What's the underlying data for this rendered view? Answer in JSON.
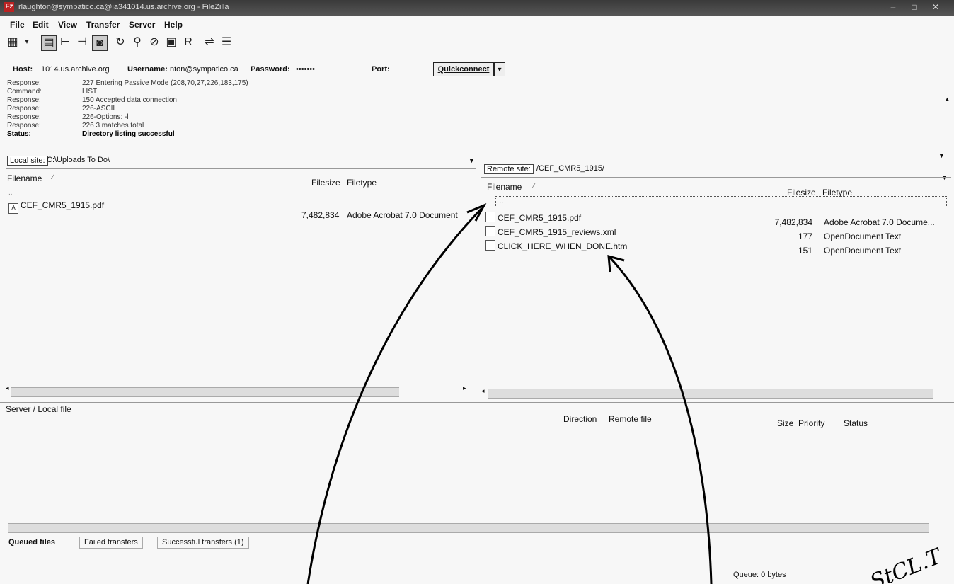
{
  "window": {
    "title": "rlaughton@sympatico.ca@ia341014.us.archive.org - FileZilla",
    "app_icon": "Fz"
  },
  "menu": [
    "File",
    "Edit",
    "View",
    "Transfer",
    "Server",
    "Help"
  ],
  "toolbar": {
    "icons": [
      "site-manager-icon",
      "dropdown-arrow-icon",
      "toggle-log-icon",
      "toggle-local-tree-icon",
      "toggle-remote-tree-icon",
      "toggle-queue-icon",
      "refresh-icon",
      "process-queue-icon",
      "cancel-icon",
      "disconnect-icon",
      "reconnect-icon",
      "compare-icon",
      "filter-icon"
    ]
  },
  "quickconnect": {
    "host_label": "Host:",
    "host_value": "1014.us.archive.org",
    "username_label": "Username:",
    "username_value": "nton@sympatico.ca",
    "password_label": "Password:",
    "password_value": "•••••••",
    "port_label": "Port:",
    "button_label": "Quickconnect",
    "dropdown_glyph": "▼"
  },
  "log": [
    {
      "k": "Response:",
      "v": "227 Entering Passive Mode (208,70,27,226,183,175)",
      "bold": false
    },
    {
      "k": "Command:",
      "v": "LIST",
      "bold": false
    },
    {
      "k": "Response:",
      "v": "150 Accepted data connection",
      "bold": false
    },
    {
      "k": "Response:",
      "v": "226-ASCII",
      "bold": false
    },
    {
      "k": "Response:",
      "v": "226-Options: -l",
      "bold": false
    },
    {
      "k": "Response:",
      "v": "226 3 matches total",
      "bold": false
    },
    {
      "k": "Status:",
      "v": "Directory listing successful",
      "bold": true
    }
  ],
  "local": {
    "site_label": "Local site:",
    "path": "C:\\Uploads To Do\\",
    "col_filename": "Filename",
    "col_filesize": "Filesize",
    "col_filetype": "Filetype",
    "parent": "..",
    "files": [
      {
        "name": "CEF_CMR5_1915.pdf",
        "size": "7,482,834",
        "type": "Adobe Acrobat 7.0 Document"
      }
    ]
  },
  "remote": {
    "site_label": "Remote site:",
    "path": "/CEF_CMR5_1915/",
    "col_filename": "Filename",
    "col_filesize": "Filesize",
    "col_filetype": "Filetype",
    "parent": "..",
    "files": [
      {
        "name": "CEF_CMR5_1915.pdf",
        "size": "7,482,834",
        "type": "Adobe Acrobat 7.0 Docume..."
      },
      {
        "name": "CEF_CMR5_1915_reviews.xml",
        "size": "177",
        "type": "OpenDocument Text"
      },
      {
        "name": "CLICK_HERE_WHEN_DONE.htm",
        "size": "151",
        "type": "OpenDocument Text"
      }
    ]
  },
  "queue": {
    "col_server_local": "Server / Local file",
    "col_direction": "Direction",
    "col_remote_file": "Remote file",
    "col_size": "Size",
    "col_priority": "Priority",
    "col_status": "Status",
    "tabs": [
      "Queued files",
      "Failed transfers",
      "Successful transfers (1)"
    ],
    "queue_status": "Queue: 0 bytes"
  },
  "annotation": {
    "handwriting": "StCL.T"
  }
}
